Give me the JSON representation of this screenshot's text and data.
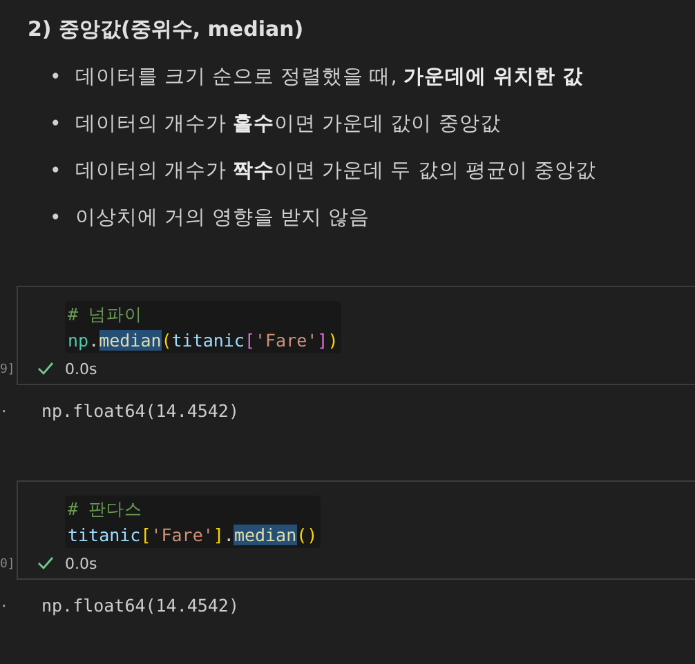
{
  "heading": "2) 중앙값(중위수, median)",
  "bullets": [
    {
      "marker": "•",
      "text": "데이터를 크기 순으로 정렬했을 때, **가운데에 위치한 값**"
    },
    {
      "marker": "•",
      "text": "데이터의 개수가 **홀수**이면 가운데 값이 중앙값"
    },
    {
      "marker": "•",
      "text": "데이터의 개수가 **짝수**이면 가운데 두 값의 평균이 중앙값"
    },
    {
      "marker": "•",
      "text": "이상치에 거의 영향을 받지 않음"
    }
  ],
  "cells": [
    {
      "count": "9]",
      "succeeded": true,
      "time": "0.0s",
      "output_marker": "·",
      "output": "np.float64(14.4542)",
      "lines": [
        [
          {
            "text": "# 넘파이",
            "kind": "comment",
            "highlight": false
          }
        ],
        [
          {
            "text": "np",
            "kind": "module",
            "highlight": false
          },
          {
            "text": ".",
            "kind": "plain",
            "highlight": false
          },
          {
            "text": "median",
            "kind": "function",
            "highlight": true
          },
          {
            "text": "(",
            "kind": "bracket1",
            "highlight": false
          },
          {
            "text": "titanic",
            "kind": "variable",
            "highlight": false
          },
          {
            "text": "[",
            "kind": "bracket2",
            "highlight": false
          },
          {
            "text": "'Fare'",
            "kind": "string",
            "highlight": false
          },
          {
            "text": "]",
            "kind": "bracket2",
            "highlight": false
          },
          {
            "text": ")",
            "kind": "bracket1",
            "highlight": false
          }
        ]
      ]
    },
    {
      "count": "0]",
      "succeeded": true,
      "time": "0.0s",
      "output_marker": "·",
      "output": "np.float64(14.4542)",
      "lines": [
        [
          {
            "text": "# 판다스",
            "kind": "comment",
            "highlight": false
          }
        ],
        [
          {
            "text": "titanic",
            "kind": "variable",
            "highlight": false
          },
          {
            "text": "[",
            "kind": "bracket1",
            "highlight": false
          },
          {
            "text": "'Fare'",
            "kind": "string",
            "highlight": false
          },
          {
            "text": "]",
            "kind": "bracket1",
            "highlight": false
          },
          {
            "text": ".",
            "kind": "plain",
            "highlight": false
          },
          {
            "text": "median",
            "kind": "function",
            "highlight": true
          },
          {
            "text": "()",
            "kind": "bracket1",
            "highlight": false
          }
        ]
      ]
    }
  ]
}
